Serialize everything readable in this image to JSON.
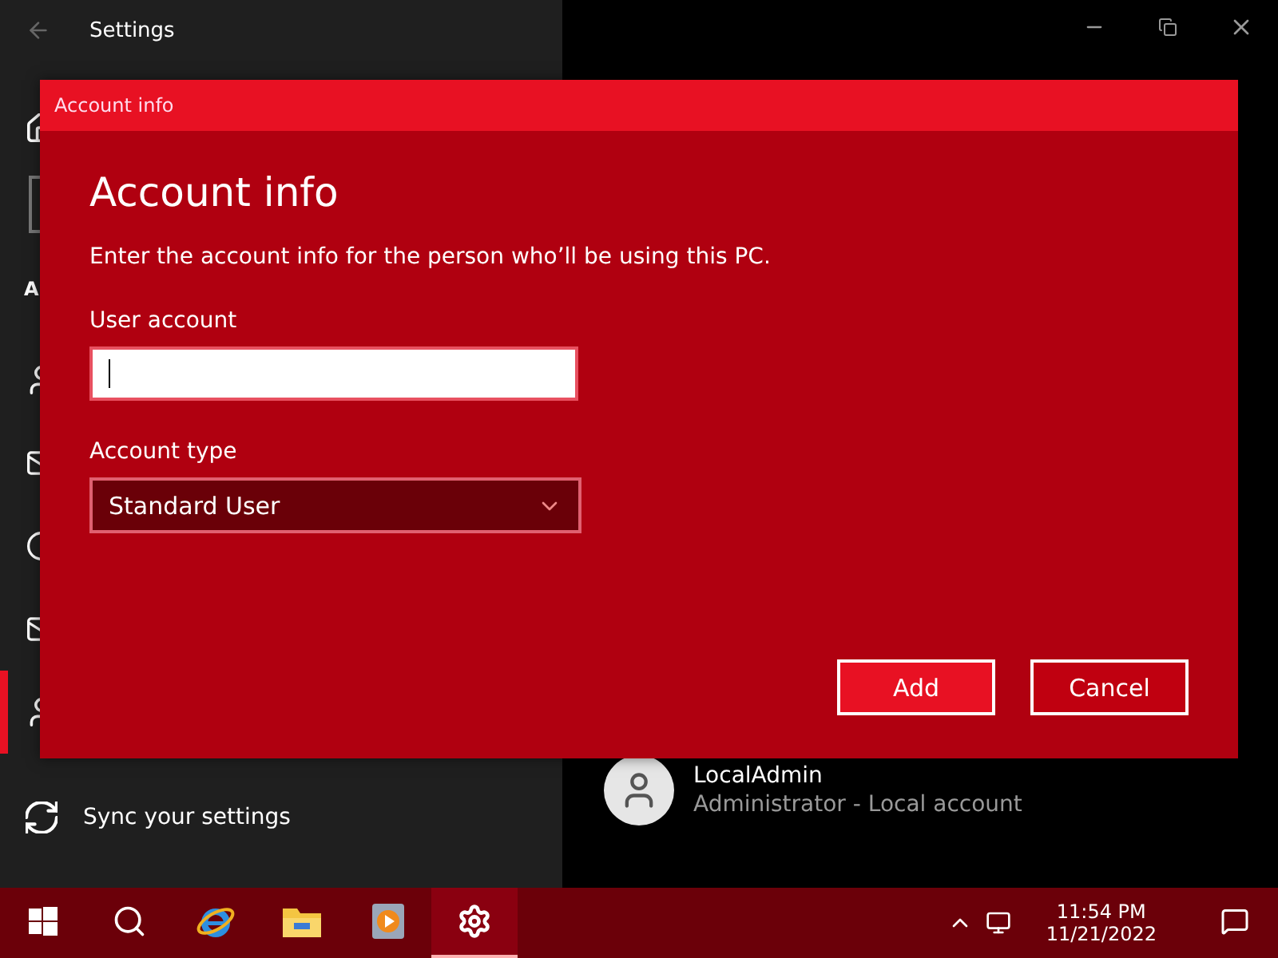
{
  "window": {
    "title": "Settings"
  },
  "sidebar": {
    "heading": "A",
    "items": [
      {
        "kind": "home",
        "selected": false
      },
      {
        "kind": "search",
        "selected": false
      },
      {
        "kind": "person",
        "selected": false
      },
      {
        "kind": "mail",
        "selected": false
      },
      {
        "kind": "key",
        "selected": false
      },
      {
        "kind": "mail",
        "selected": false
      },
      {
        "kind": "person",
        "selected": true
      }
    ],
    "sync_label": "Sync your settings"
  },
  "account": {
    "name": "LocalAdmin",
    "description": "Administrator - Local account"
  },
  "dialog": {
    "title": "Account info",
    "heading": "Account info",
    "instructions": "Enter the account info for the person who’ll be using this PC.",
    "user_account": {
      "label": "User account",
      "focused": true
    },
    "account_type": {
      "label": "Account type",
      "value": "Standard User"
    },
    "buttons": [
      {
        "label": "Add",
        "kind": "primary"
      },
      {
        "label": "Cancel",
        "kind": "secondary"
      }
    ]
  },
  "taskbar": {
    "apps": [
      {
        "kind": "search",
        "selected": false
      },
      {
        "kind": "browser",
        "selected": false
      },
      {
        "kind": "folder",
        "selected": false
      },
      {
        "kind": "media",
        "selected": false
      },
      {
        "kind": "settings",
        "selected": true
      }
    ],
    "time": "11:54 PM",
    "date": "11/21/2022"
  }
}
